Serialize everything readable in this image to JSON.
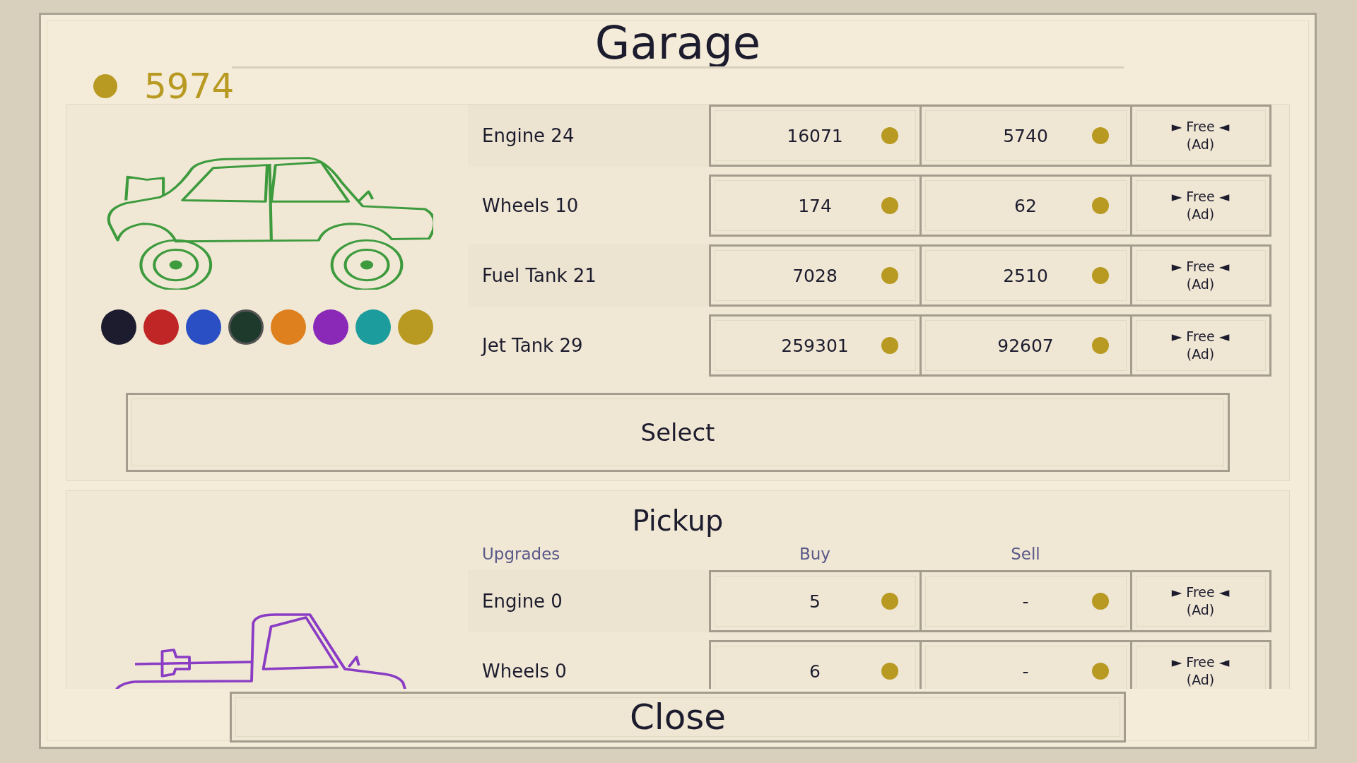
{
  "title": "Garage",
  "coins": "5974",
  "vehicles": [
    {
      "kind": "sedan",
      "color": "#3d9a3d",
      "swatches": [
        {
          "color": "#1d1c2e",
          "selected": false
        },
        {
          "color": "#c02626",
          "selected": false
        },
        {
          "color": "#2a4fc4",
          "selected": false
        },
        {
          "color": "#1e3a2c",
          "selected": true
        },
        {
          "color": "#de801e",
          "selected": false
        },
        {
          "color": "#8a28b8",
          "selected": false
        },
        {
          "color": "#1c9c9c",
          "selected": false
        },
        {
          "color": "#b89a22",
          "selected": false
        }
      ],
      "upgrades": [
        {
          "name": "Engine 24",
          "buy": "16071",
          "sell": "5740",
          "ad": "► Free ◄",
          "ad_note": "(Ad)"
        },
        {
          "name": "Wheels 10",
          "buy": "174",
          "sell": "62",
          "ad": "► Free ◄",
          "ad_note": "(Ad)"
        },
        {
          "name": "Fuel Tank 21",
          "buy": "7028",
          "sell": "2510",
          "ad": "► Free ◄",
          "ad_note": "(Ad)"
        },
        {
          "name": "Jet Tank 29",
          "buy": "259301",
          "sell": "92607",
          "ad": "► Free ◄",
          "ad_note": "(Ad)"
        }
      ],
      "select_button": "Select"
    },
    {
      "kind": "pickup",
      "name": "Pickup",
      "color": "#8a3cc4",
      "columns": [
        "Upgrades",
        "Buy",
        "Sell"
      ],
      "upgrades": [
        {
          "name": "Engine 0",
          "buy": "5",
          "sell": "-",
          "ad": "► Free ◄",
          "ad_note": "(Ad)"
        },
        {
          "name": "Wheels 0",
          "buy": "6",
          "sell": "-",
          "ad": "► Free ◄",
          "ad_note": "(Ad)"
        }
      ]
    }
  ],
  "close_button": "Close"
}
